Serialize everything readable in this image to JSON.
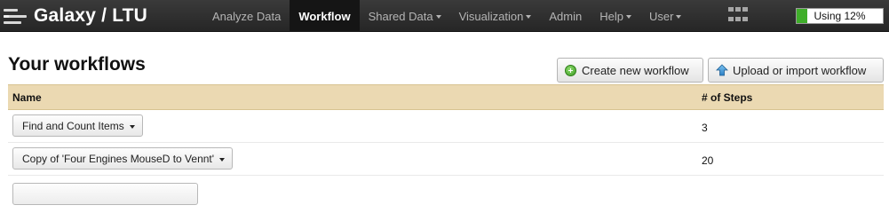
{
  "brand": {
    "title": "Galaxy / LTU",
    "logo_icon": "galaxy-logo-icon"
  },
  "nav": {
    "items": [
      {
        "label": "Analyze Data",
        "active": false,
        "dropdown": false
      },
      {
        "label": "Workflow",
        "active": true,
        "dropdown": false
      },
      {
        "label": "Shared Data",
        "active": false,
        "dropdown": true
      },
      {
        "label": "Visualization",
        "active": false,
        "dropdown": true
      },
      {
        "label": "Admin",
        "active": false,
        "dropdown": false
      },
      {
        "label": "Help",
        "active": false,
        "dropdown": true
      },
      {
        "label": "User",
        "active": false,
        "dropdown": true
      }
    ],
    "apps_icon": "grid-icon"
  },
  "quota": {
    "label": "Using 12%",
    "percent": 12,
    "color": "#3fae2a"
  },
  "page": {
    "title": "Your workflows"
  },
  "actions": {
    "create_label": "Create new workflow",
    "create_icon": "plus-circle-icon",
    "upload_label": "Upload or import workflow",
    "upload_icon": "arrow-up-icon"
  },
  "table": {
    "columns": [
      "Name",
      "# of Steps"
    ],
    "rows": [
      {
        "name": "Find and Count Items",
        "steps": "3"
      },
      {
        "name": "Copy of 'Four Engines MouseD to Vennt'",
        "steps": "20"
      }
    ]
  },
  "colors": {
    "masthead": "#2e2e2e",
    "table_header": "#ebd9b2",
    "active_nav": "#151515"
  }
}
